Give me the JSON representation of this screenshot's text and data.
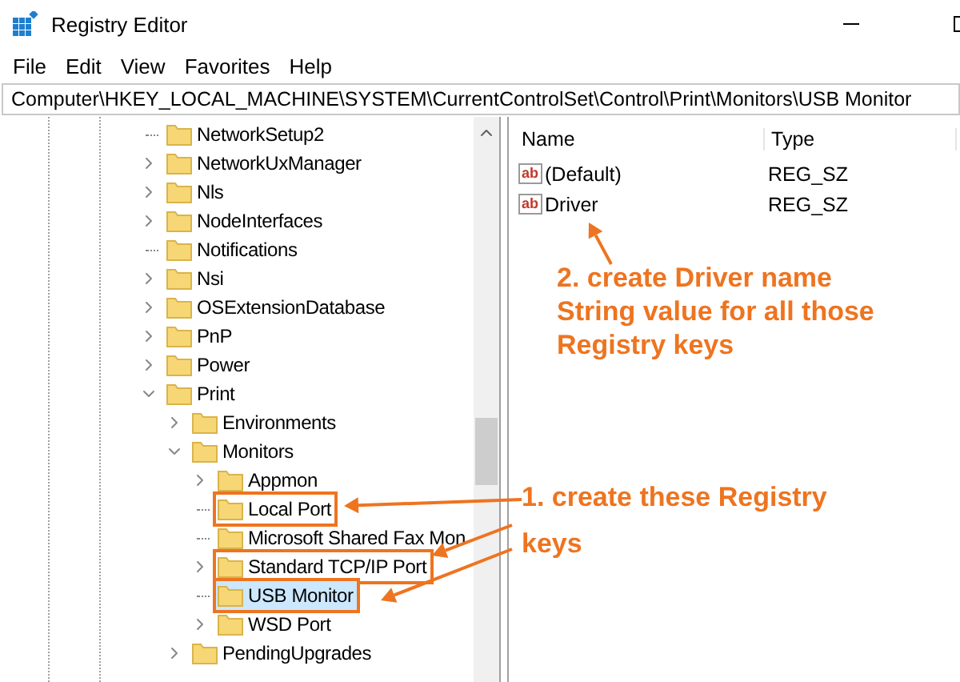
{
  "window": {
    "title": "Registry Editor"
  },
  "menu": [
    "File",
    "Edit",
    "View",
    "Favorites",
    "Help"
  ],
  "address": "Computer\\HKEY_LOCAL_MACHINE\\SYSTEM\\CurrentControlSet\\Control\\Print\\Monitors\\USB Monitor",
  "tree": [
    {
      "label": "NetworkSetup2",
      "expandable": false,
      "selected": false,
      "highlighted": false
    },
    {
      "label": "NetworkUxManager",
      "expandable": true,
      "expanded": false,
      "selected": false,
      "highlighted": false
    },
    {
      "label": "Nls",
      "expandable": true,
      "expanded": false,
      "selected": false,
      "highlighted": false
    },
    {
      "label": "NodeInterfaces",
      "expandable": true,
      "expanded": false,
      "selected": false,
      "highlighted": false
    },
    {
      "label": "Notifications",
      "expandable": false,
      "selected": false,
      "highlighted": false
    },
    {
      "label": "Nsi",
      "expandable": true,
      "expanded": false,
      "selected": false,
      "highlighted": false
    },
    {
      "label": "OSExtensionDatabase",
      "expandable": true,
      "expanded": false,
      "selected": false,
      "highlighted": false
    },
    {
      "label": "PnP",
      "expandable": true,
      "expanded": false,
      "selected": false,
      "highlighted": false
    },
    {
      "label": "Power",
      "expandable": true,
      "expanded": false,
      "selected": false,
      "highlighted": false
    },
    {
      "label": "Print",
      "expandable": true,
      "expanded": true,
      "selected": false,
      "highlighted": false,
      "children": [
        {
          "label": "Environments",
          "expandable": true,
          "expanded": false,
          "selected": false,
          "highlighted": false
        },
        {
          "label": "Monitors",
          "expandable": true,
          "expanded": true,
          "selected": false,
          "highlighted": false,
          "children": [
            {
              "label": "Appmon",
              "expandable": true,
              "expanded": false,
              "selected": false,
              "highlighted": false
            },
            {
              "label": "Local Port",
              "expandable": false,
              "selected": false,
              "highlighted": true
            },
            {
              "label": "Microsoft Shared Fax Mon",
              "expandable": false,
              "selected": false,
              "highlighted": false
            },
            {
              "label": "Standard TCP/IP Port",
              "expandable": true,
              "expanded": false,
              "selected": false,
              "highlighted": true
            },
            {
              "label": "USB Monitor",
              "expandable": false,
              "selected": true,
              "highlighted": true
            },
            {
              "label": "WSD Port",
              "expandable": true,
              "expanded": false,
              "selected": false,
              "highlighted": false
            }
          ]
        },
        {
          "label": "PendingUpgrades",
          "expandable": true,
          "expanded": false,
          "selected": false,
          "highlighted": false
        }
      ]
    }
  ],
  "values": {
    "columns": [
      "Name",
      "Type"
    ],
    "rows": [
      {
        "icon_text": "ab",
        "name": "(Default)",
        "type": "REG_SZ"
      },
      {
        "icon_text": "ab",
        "name": "Driver",
        "type": "REG_SZ"
      }
    ]
  },
  "annotations": [
    {
      "text": "2. create Driver name String value for all those Registry keys"
    },
    {
      "text": "1. create these Registry keys"
    }
  ]
}
